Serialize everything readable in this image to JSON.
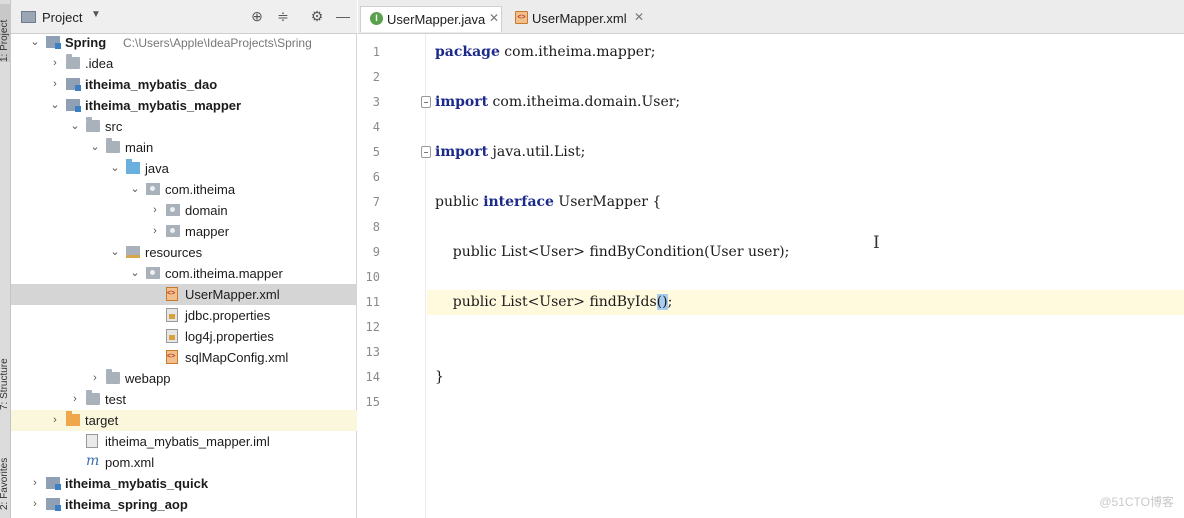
{
  "side_tabs": {
    "project": "1: Project",
    "structure": "7: Structure",
    "favorites": "2: Favorites"
  },
  "project_panel": {
    "title": "Project",
    "tree": [
      {
        "label": "Spring",
        "path": "C:\\Users\\Apple\\IdeaProjects\\Spring",
        "bold": true,
        "icon": "module-folder-icon",
        "arrow": "expanded"
      },
      {
        "label": ".idea",
        "icon": "folder-icon",
        "arrow": "collapsed"
      },
      {
        "label": "itheima_mybatis_dao",
        "bold": true,
        "icon": "module-folder-icon",
        "arrow": "collapsed"
      },
      {
        "label": "itheima_mybatis_mapper",
        "bold": true,
        "icon": "module-folder-icon",
        "arrow": "expanded"
      },
      {
        "label": "src",
        "icon": "folder-icon",
        "arrow": "expanded"
      },
      {
        "label": "main",
        "icon": "folder-icon",
        "arrow": "expanded"
      },
      {
        "label": "java",
        "icon": "source-folder-icon",
        "arrow": "expanded"
      },
      {
        "label": "com.itheima",
        "icon": "package-icon",
        "arrow": "expanded"
      },
      {
        "label": "domain",
        "icon": "package-icon",
        "arrow": "collapsed"
      },
      {
        "label": "mapper",
        "icon": "package-icon",
        "arrow": "collapsed"
      },
      {
        "label": "resources",
        "icon": "resources-folder-icon",
        "arrow": "expanded"
      },
      {
        "label": "com.itheima.mapper",
        "icon": "package-icon",
        "arrow": "expanded"
      },
      {
        "label": "UserMapper.xml",
        "icon": "xml-file-icon",
        "selected": true
      },
      {
        "label": "jdbc.properties",
        "icon": "properties-file-icon"
      },
      {
        "label": "log4j.properties",
        "icon": "properties-file-icon"
      },
      {
        "label": "sqlMapConfig.xml",
        "icon": "xml-file-icon"
      },
      {
        "label": "webapp",
        "icon": "folder-icon",
        "arrow": "collapsed"
      },
      {
        "label": "test",
        "icon": "folder-icon",
        "arrow": "collapsed"
      },
      {
        "label": "target",
        "icon": "excluded-folder-icon",
        "arrow": "collapsed",
        "highlighted": true
      },
      {
        "label": "itheima_mybatis_mapper.iml",
        "icon": "iml-file-icon"
      },
      {
        "label": "pom.xml",
        "icon": "maven-icon"
      },
      {
        "label": "itheima_mybatis_quick",
        "bold": true,
        "icon": "module-folder-icon",
        "arrow": "collapsed"
      },
      {
        "label": "itheima_spring_aop",
        "bold": true,
        "icon": "module-folder-icon",
        "arrow": "collapsed"
      }
    ]
  },
  "editor": {
    "tabs": [
      {
        "label": "UserMapper.java",
        "icon": "interface-icon",
        "active": true
      },
      {
        "label": "UserMapper.xml",
        "icon": "xml-file-icon",
        "active": false
      }
    ],
    "current_line": 11,
    "lines": [
      {
        "n": "1",
        "tokens": [
          [
            "kw",
            "package"
          ],
          [
            "",
            " com.itheima.mapper;"
          ]
        ]
      },
      {
        "n": "2",
        "tokens": []
      },
      {
        "n": "3",
        "fold": true,
        "tokens": [
          [
            "kw",
            "import"
          ],
          [
            "",
            " com.itheima.domain.User;"
          ]
        ]
      },
      {
        "n": "4",
        "tokens": []
      },
      {
        "n": "5",
        "fold": true,
        "tokens": [
          [
            "kw",
            "import"
          ],
          [
            "",
            " java.util.List;"
          ]
        ]
      },
      {
        "n": "6",
        "tokens": []
      },
      {
        "n": "7",
        "tokens": [
          [
            "",
            "public "
          ],
          [
            "kw",
            "interface"
          ],
          [
            "",
            " UserMapper {"
          ]
        ]
      },
      {
        "n": "8",
        "tokens": []
      },
      {
        "n": "9",
        "tokens": [
          [
            "",
            "    public List<User> findByCondition(User user);"
          ]
        ]
      },
      {
        "n": "10",
        "tokens": []
      },
      {
        "n": "11",
        "tokens": [
          [
            "",
            "    public List<User> findByIds"
          ],
          [
            "caret",
            "()"
          ],
          [
            "",
            ";"
          ]
        ]
      },
      {
        "n": "12",
        "tokens": []
      },
      {
        "n": "13",
        "tokens": []
      },
      {
        "n": "14",
        "tokens": [
          [
            "",
            "}"
          ]
        ]
      },
      {
        "n": "15",
        "tokens": []
      }
    ]
  },
  "watermark": "@51CTO博客",
  "colors": {
    "keyword": "#1c2a8a",
    "current_line": "#fff9de",
    "selection": "#d5d5d5",
    "caret_highlight": "#a8cdf0"
  }
}
